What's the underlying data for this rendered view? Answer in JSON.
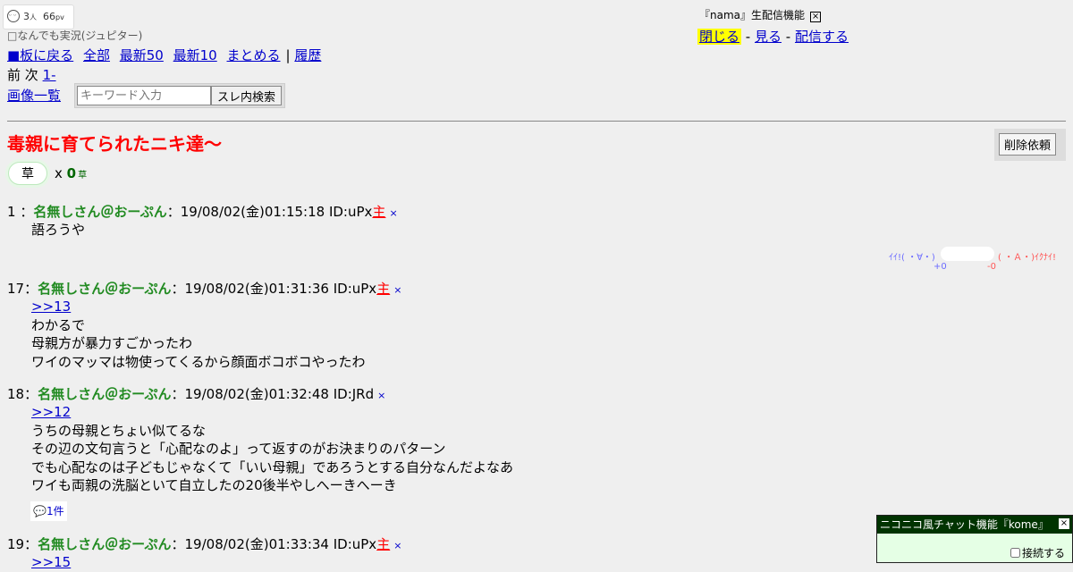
{
  "header": {
    "viewers": "3",
    "viewers_unit": "人",
    "pv": "66",
    "pv_unit": "pv",
    "board_name": "なんでも実況(ジュピター)"
  },
  "nav": {
    "back_board": "■板に戻る",
    "all": "全部",
    "latest50": "最新50",
    "latest10": "最新10",
    "summarize": "まとめる",
    "separator": "|",
    "history": "履歴",
    "prev": "前",
    "next": "次",
    "range": "1-",
    "image_list": "画像一覧"
  },
  "search": {
    "placeholder": "キーワード入力",
    "button": "スレ内検索"
  },
  "nama": {
    "title": "『nama』生配信機能",
    "close": "閉じる",
    "dash": "-",
    "watch": "見る",
    "broadcast": "配信する"
  },
  "thread": {
    "title": "毒親に育てられたニキ達〜",
    "delete_request": "削除依頼",
    "kusa_label": "草",
    "kusa_x": "x",
    "kusa_count": "0",
    "kusa_mini": "草"
  },
  "vote": {
    "good_label": "ｲｲ!( ・∀・)",
    "bad_label": "( ・Ａ・)ｲｸﾅｲ!",
    "good_count": "+0",
    "bad_count": "-0"
  },
  "posts": [
    {
      "num": "1",
      "sep": "：",
      "name": "名無しさん＠おーぷん",
      "meta": "：19/08/02(金)01:15:18 ID:uPx",
      "owner": "主",
      "x": "×",
      "anchor": "",
      "lines": [
        "語ろうや"
      ]
    },
    {
      "num": "17",
      "sep": "：",
      "name": "名無しさん＠おーぷん",
      "meta": "：19/08/02(金)01:31:36 ID:uPx",
      "owner": "主",
      "x": "×",
      "anchor": ">>13",
      "lines": [
        "わかるで",
        "母親方が暴力すごかったわ",
        "ワイのマッマは物使ってくるから顔面ボコボコやったわ"
      ]
    },
    {
      "num": "18",
      "sep": "：",
      "name": "名無しさん＠おーぷん",
      "meta": "：19/08/02(金)01:32:48 ID:JRd",
      "owner": "",
      "x": "×",
      "anchor": ">>12",
      "lines": [
        "うちの母親とちょい似てるな",
        "その辺の文句言うと「心配なのよ」って返すのがお決まりのパターン",
        "でも心配なのは子どもじゃなくて「いい母親」であろうとする自分なんだよなあ",
        "ワイも両親の洗脳といて自立したの20後半やしへーきへーき"
      ],
      "replies": "1件"
    },
    {
      "num": "19",
      "sep": "：",
      "name": "名無しさん＠おーぷん",
      "meta": "：19/08/02(金)01:33:34 ID:uPx",
      "owner": "主",
      "x": "×",
      "anchor": ">>15",
      "lines": []
    }
  ],
  "chat": {
    "title": "ニコニコ風チャット機能『kome』",
    "close": "×",
    "connect": "接続する"
  }
}
